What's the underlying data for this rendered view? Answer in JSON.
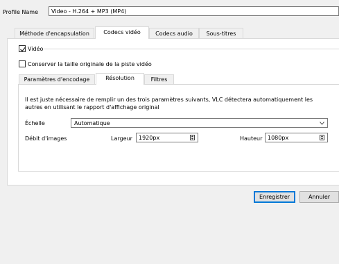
{
  "profile": {
    "label": "Profile Name",
    "value": "Video - H.264 + MP3 (MP4)"
  },
  "tabs": [
    "Méthode d'encapsulation",
    "Codecs vidéo",
    "Codecs audio",
    "Sous-titres"
  ],
  "active_tab": "Codecs vidéo",
  "video": {
    "checkbox_label": "Vidéo",
    "checked": true
  },
  "keep_size": {
    "label": "Conserver la taille originale de la piste vidéo",
    "checked": false
  },
  "subtabs": [
    "Paramètres d'encodage",
    "Résolution",
    "Filtres"
  ],
  "active_subtab": "Résolution",
  "resolution": {
    "info_line1": "Il est juste nécessaire de remplir un des trois paramètres suivants, VLC détectera automatiquement les",
    "info_line2": "autres en utilisant le rapport d'affichage original",
    "scale_label": "Échelle",
    "scale_value": "Automatique",
    "framerate_label": "Débit d'images",
    "width_label": "Largeur",
    "width_value": "1920px",
    "height_label": "Hauteur",
    "height_value": "1080px"
  },
  "buttons": {
    "save": "Enregistrer",
    "cancel": "Annuler"
  },
  "colors": {
    "accent": "#0078d7",
    "panel": "#ffffff",
    "window": "#f0f0f0"
  }
}
